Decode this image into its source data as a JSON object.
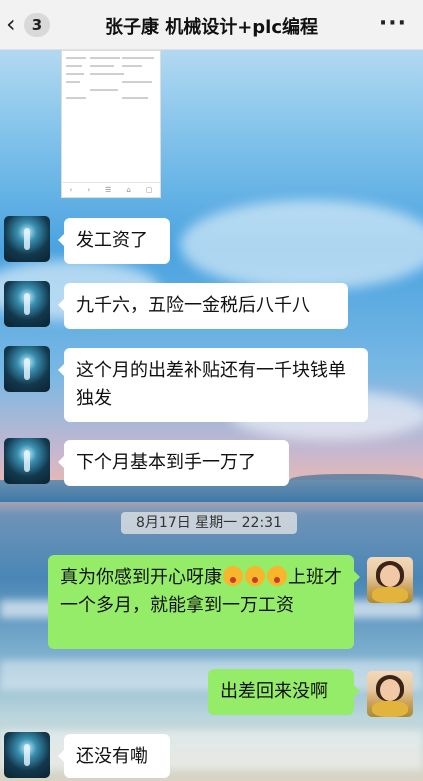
{
  "header": {
    "unread_count": "3",
    "title": "张子康 机械设计+plc编程",
    "more_glyph": "···",
    "back_glyph": "‹"
  },
  "thumbnail_nav": [
    "‹",
    "›",
    "☰",
    "⌂",
    "▢"
  ],
  "messages": [
    {
      "side": "left",
      "text": "发工资了"
    },
    {
      "side": "left",
      "text": "九千六，五险一金税后八千八"
    },
    {
      "side": "left",
      "text": "这个月的出差补贴还有一千块钱单独发"
    },
    {
      "side": "left",
      "text": "下个月基本到手一万了"
    },
    {
      "side": "right",
      "text_before": "真为你感到开心呀康",
      "emoji": [
        "astonished-face",
        "astonished-face",
        "astonished-face"
      ],
      "text_after": "上班才一个多月，就能拿到一万工资"
    },
    {
      "side": "right",
      "text": "出差回来没啊"
    },
    {
      "side": "left",
      "text": "还没有嘞"
    }
  ],
  "timestamp": "8月17日 星期一 22:31",
  "colors": {
    "sent_bubble": "#95ec69",
    "received_bubble": "#ffffff",
    "header_bg": "#f2f2f2"
  }
}
